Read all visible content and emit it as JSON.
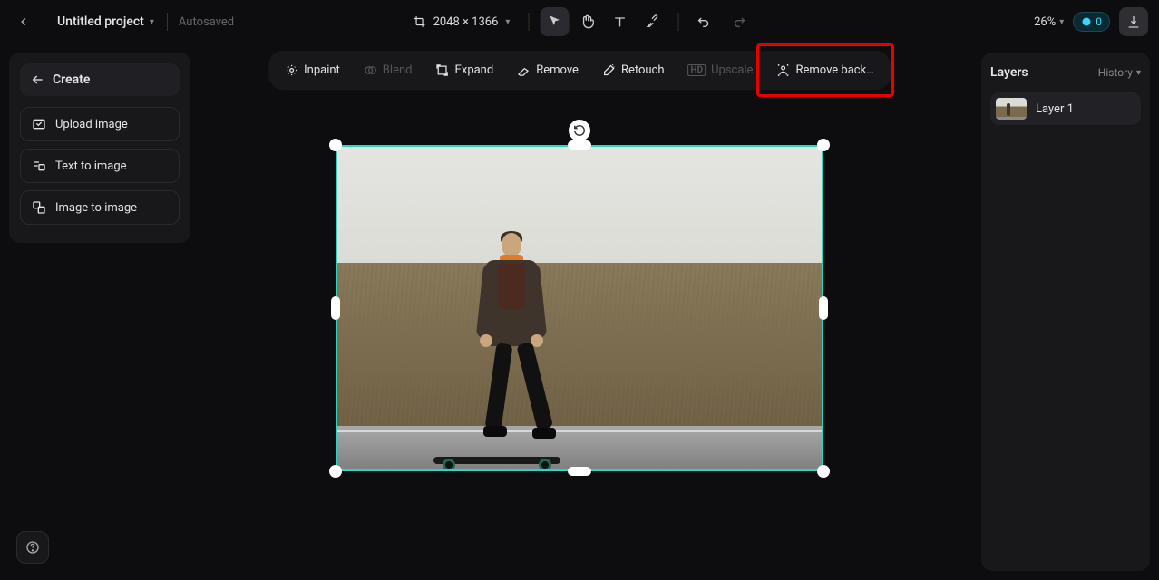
{
  "topbar": {
    "project_name": "Untitled project",
    "autosaved_label": "Autosaved",
    "dimensions": "2048 × 1366",
    "zoom": "26%",
    "credits": "0"
  },
  "left_panel": {
    "create_label": "Create",
    "buttons": [
      {
        "label": "Upload image"
      },
      {
        "label": "Text to image"
      },
      {
        "label": "Image to image"
      }
    ]
  },
  "action_bar": {
    "items": [
      {
        "label": "Inpaint",
        "disabled": false
      },
      {
        "label": "Blend",
        "disabled": true
      },
      {
        "label": "Expand",
        "disabled": false
      },
      {
        "label": "Remove",
        "disabled": false
      },
      {
        "label": "Retouch",
        "disabled": false
      },
      {
        "label": "Upscale",
        "disabled": true
      },
      {
        "label": "Remove back…",
        "disabled": false
      }
    ]
  },
  "right_panel": {
    "title": "Layers",
    "history_label": "History",
    "layers": [
      {
        "name": "Layer 1"
      }
    ]
  },
  "highlight": {
    "action_index": 6
  }
}
